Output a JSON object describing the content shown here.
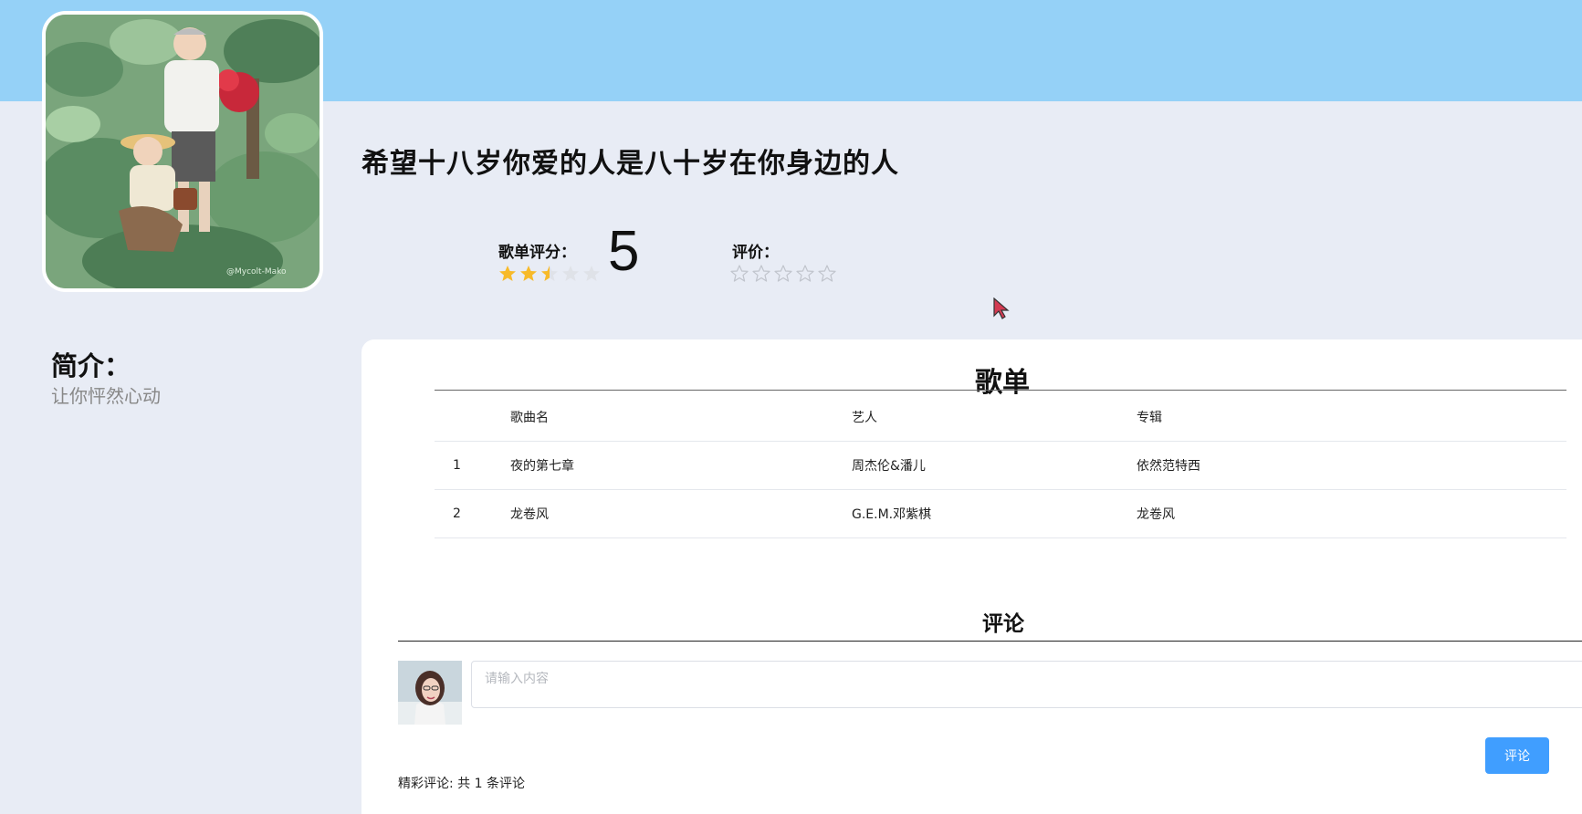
{
  "playlist": {
    "title": "希望十八岁你爱的人是八十岁在你身边的人",
    "rating_label": "歌单评分：",
    "rating_value": "5",
    "rating_stars": 2.5,
    "review_label": "评价：",
    "review_stars": 0
  },
  "intro": {
    "heading": "简介：",
    "text": "让你怦然心动"
  },
  "songlist": {
    "title": "歌单",
    "columns": [
      "",
      "歌曲名",
      "艺人",
      "专辑"
    ],
    "rows": [
      {
        "index": "1",
        "name": "夜的第七章",
        "artist": "周杰伦&潘儿",
        "album": "依然范特西"
      },
      {
        "index": "2",
        "name": "龙卷风",
        "artist": "G.E.M.邓紫棋",
        "album": "龙卷风"
      }
    ]
  },
  "comments": {
    "title": "评论",
    "input_placeholder": "请输入内容",
    "submit_label": "评论",
    "count_text": "精彩评论: 共 1 条评论"
  },
  "colors": {
    "top_band": "#95d1f7",
    "background": "#e8ecf5",
    "star_active": "#f7ba2a",
    "star_inactive": "#dfe2e8",
    "button": "#409eff"
  },
  "icons": {
    "rating": "star-icon",
    "cursor": "mouse-pointer-icon"
  }
}
